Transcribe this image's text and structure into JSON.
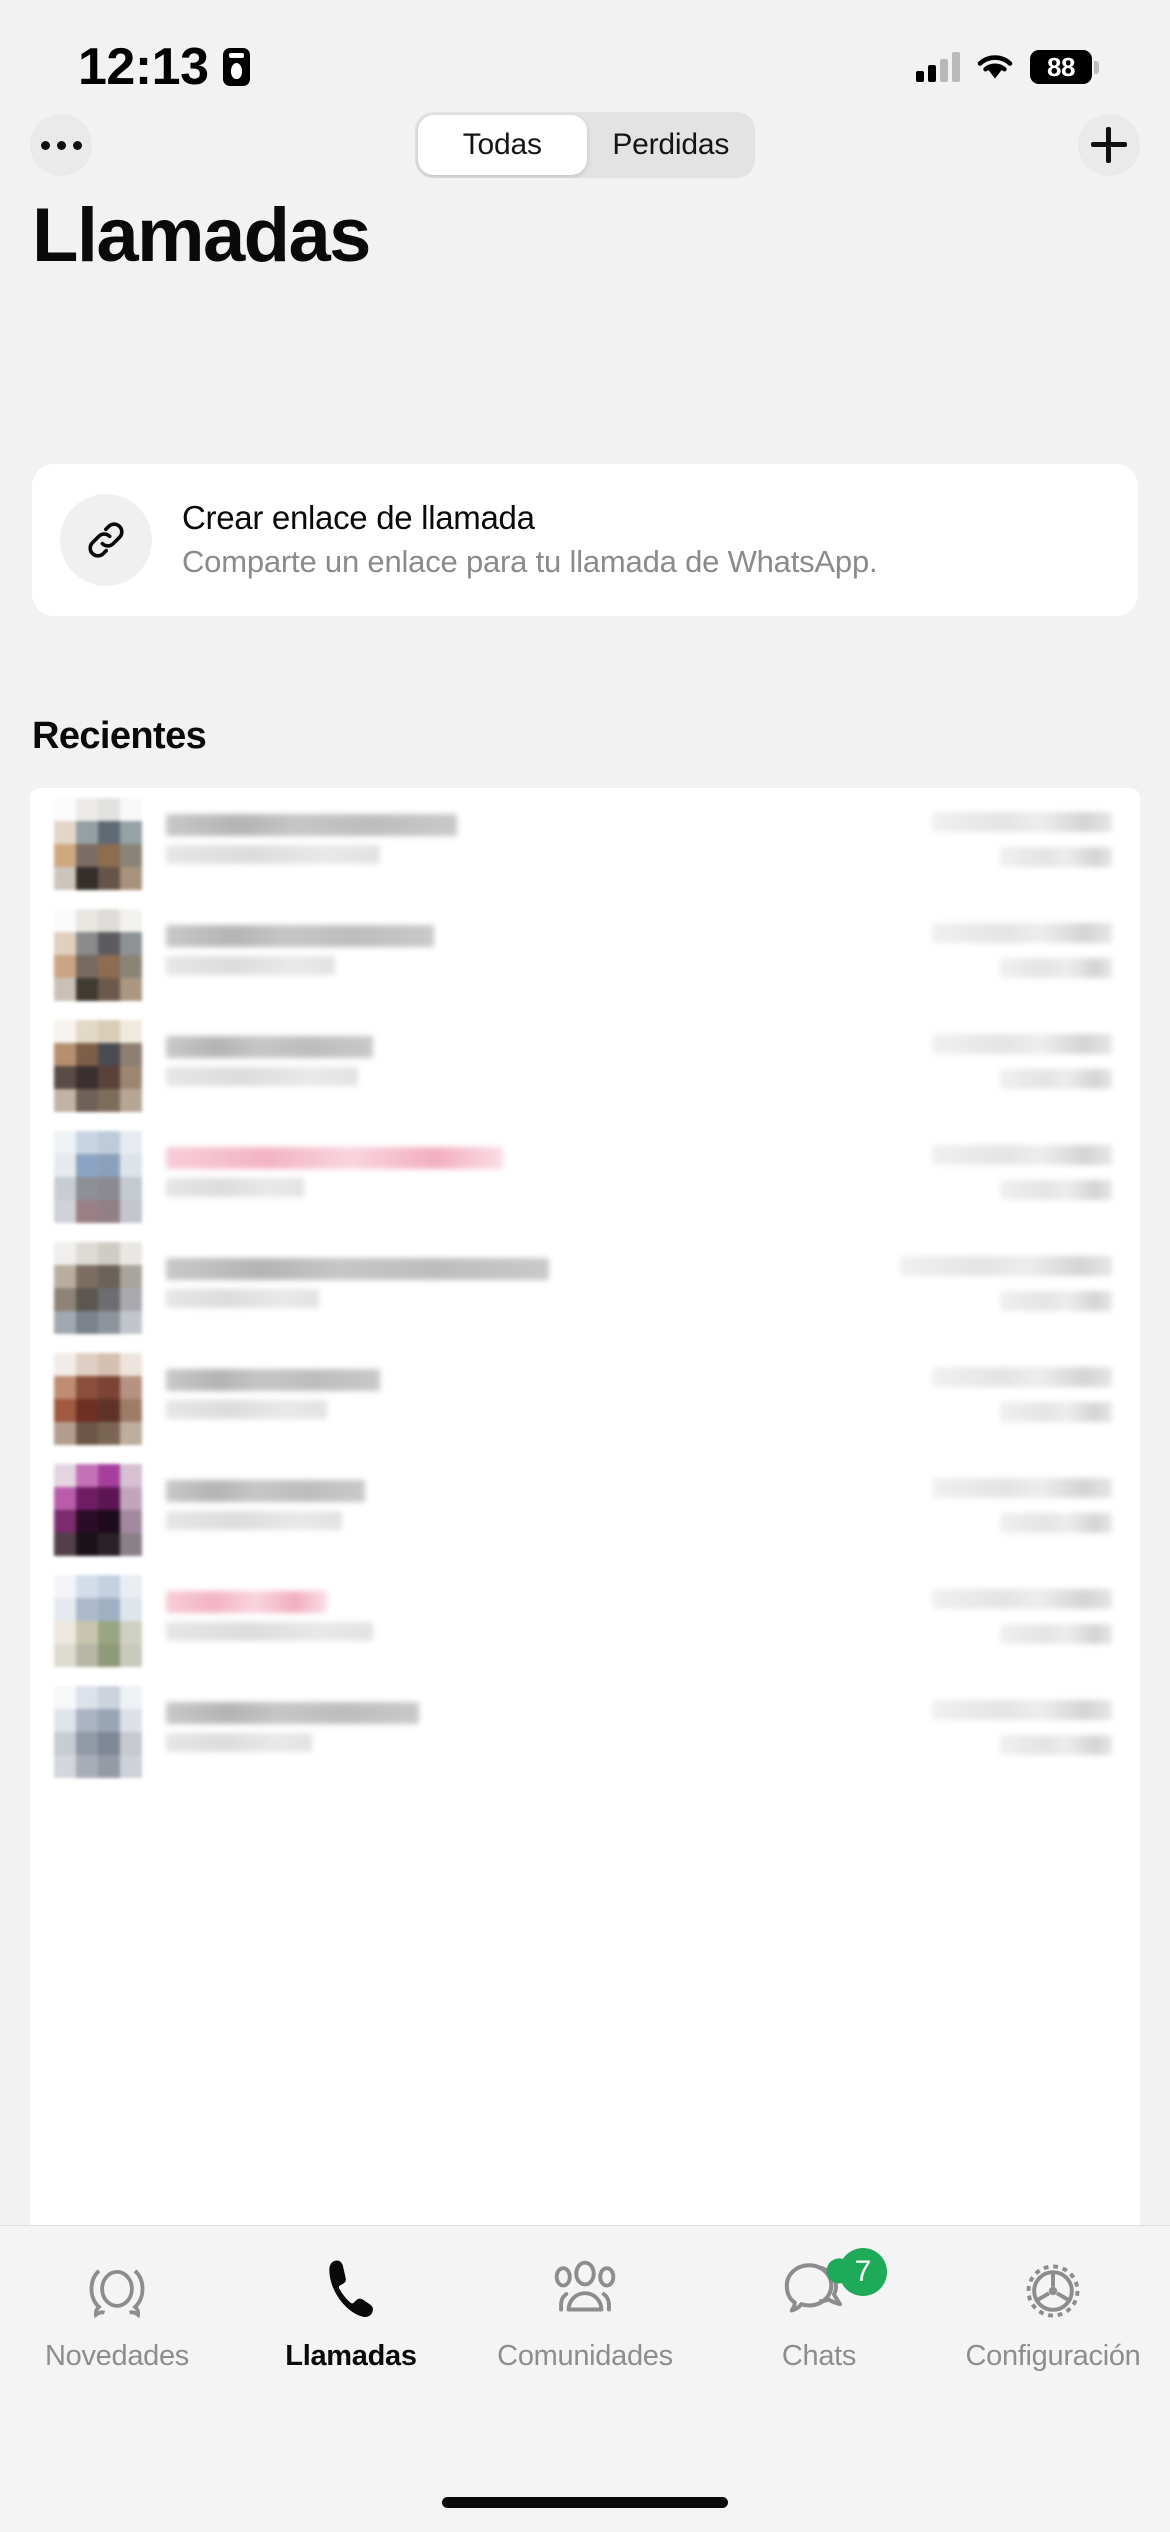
{
  "status_bar": {
    "time": "12:13",
    "recording_icon": "privacy-indicator-icon",
    "signal_icon": "cellular-signal-icon",
    "wifi_icon": "wifi-icon",
    "battery_level": "88"
  },
  "top_bar": {
    "more_button": "more-options-icon",
    "new_call_button": "plus-icon",
    "segments": [
      {
        "label": "Todas",
        "selected": true
      },
      {
        "label": "Perdidas",
        "selected": false
      }
    ]
  },
  "header": {
    "title": "Llamadas"
  },
  "link_card": {
    "icon": "link-icon",
    "title": "Crear enlace de llamada",
    "subtitle": "Comparte un enlace para tu llamada de WhatsApp."
  },
  "recents": {
    "section_title": "Recientes",
    "rows": [
      {
        "missed": false
      },
      {
        "missed": false
      },
      {
        "missed": false
      },
      {
        "missed": true
      },
      {
        "missed": false
      },
      {
        "missed": false
      },
      {
        "missed": false
      },
      {
        "missed": true
      },
      {
        "missed": false
      }
    ]
  },
  "tab_bar": {
    "items": [
      {
        "label": "Novedades",
        "icon": "status-ring-icon",
        "active": false,
        "badge": null
      },
      {
        "label": "Llamadas",
        "icon": "phone-icon",
        "active": true,
        "badge": null
      },
      {
        "label": "Comunidades",
        "icon": "communities-icon",
        "active": false,
        "badge": null
      },
      {
        "label": "Chats",
        "icon": "chats-bubble-icon",
        "active": false,
        "badge": "7"
      },
      {
        "label": "Configuración",
        "icon": "gear-icon",
        "active": false,
        "badge": null
      }
    ]
  },
  "colors": {
    "background": "#f2f2f2",
    "card": "#ffffff",
    "accent_badge": "#1faa59",
    "muted_text": "#8b8b8d",
    "missed_call": "#e8637f"
  }
}
